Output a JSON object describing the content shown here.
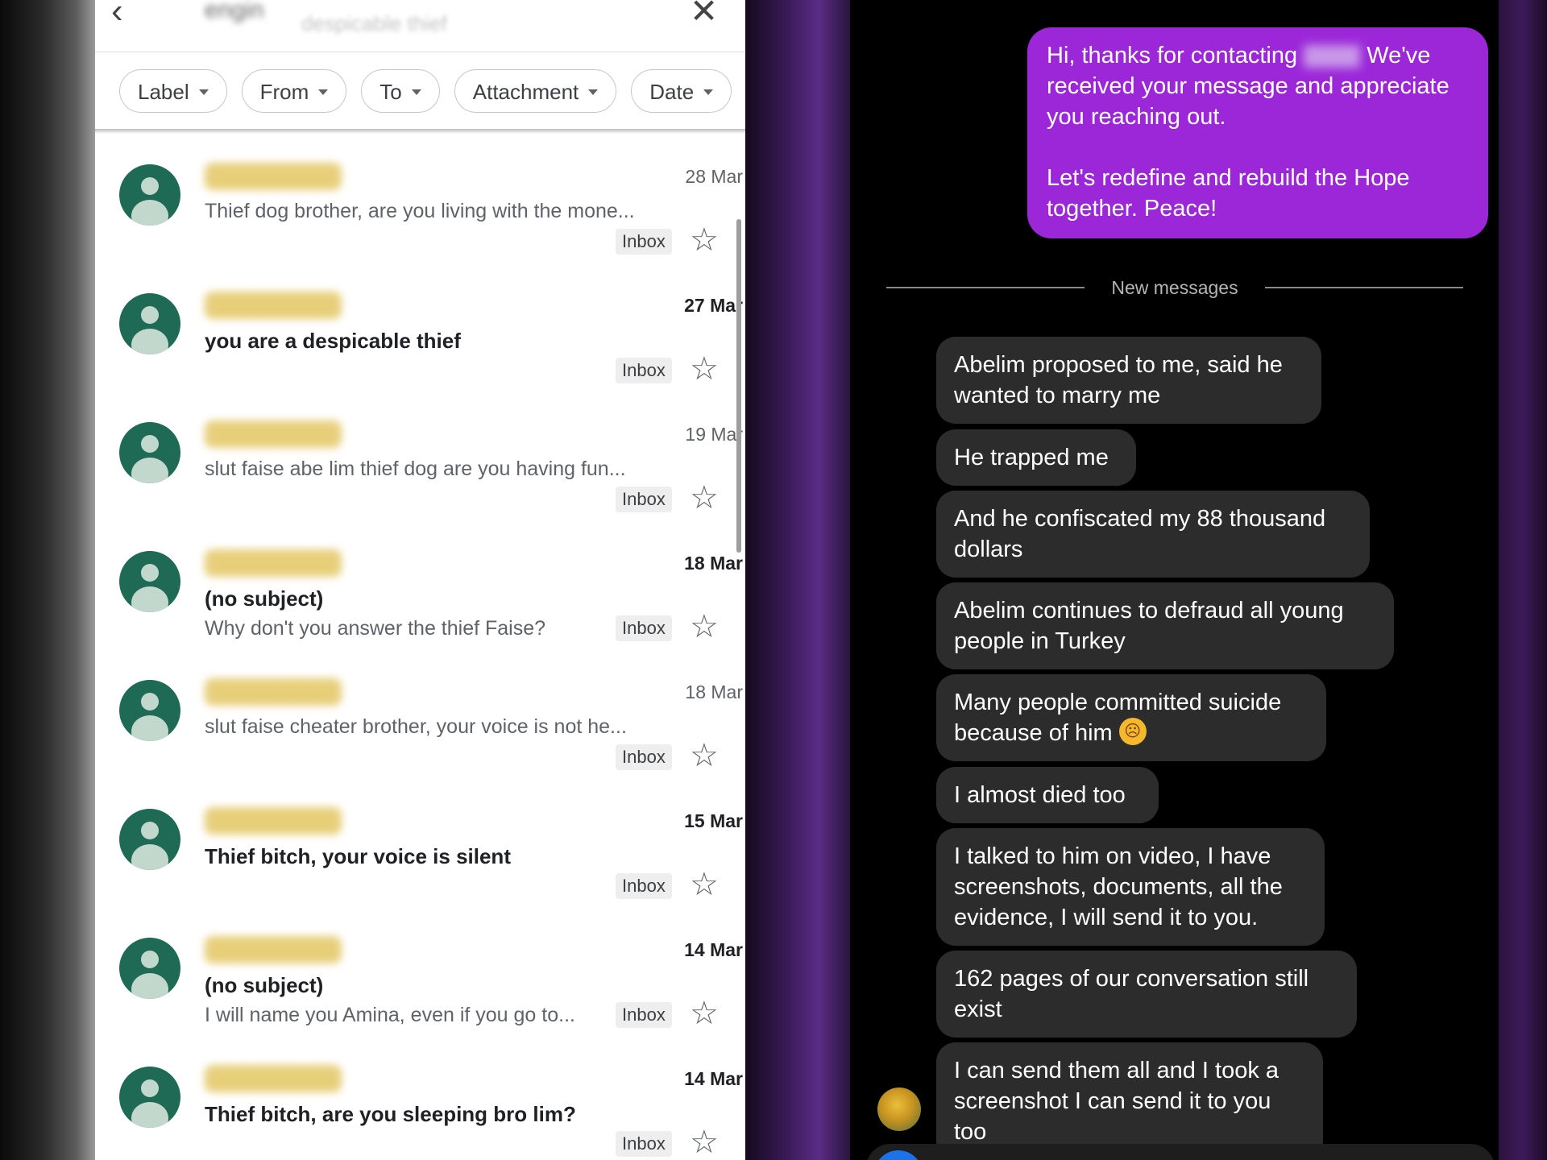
{
  "gmail": {
    "search_query": "engin",
    "search_ghost_text": "despicable thief",
    "filter_chips": [
      "Label",
      "From",
      "To",
      "Attachment",
      "Date"
    ],
    "emails": [
      {
        "date": "28 Mar",
        "unread": false,
        "subject": "",
        "snippet": "Thief dog brother, are you living with the mone...",
        "label": "Inbox"
      },
      {
        "date": "27 Mar",
        "unread": true,
        "subject": "you are a despicable thief",
        "snippet": "",
        "label": "Inbox"
      },
      {
        "date": "19 Mar",
        "unread": false,
        "subject": "",
        "snippet": "slut faise abe lim thief dog are you having fun...",
        "label": "Inbox"
      },
      {
        "date": "18 Mar",
        "unread": true,
        "subject": "(no subject)",
        "snippet": "Why don't you answer the thief Faise?",
        "label": "Inbox"
      },
      {
        "date": "18 Mar",
        "unread": false,
        "subject": "",
        "snippet": "slut faise cheater brother, your voice is not he...",
        "label": "Inbox"
      },
      {
        "date": "15 Mar",
        "unread": true,
        "subject": "Thief bitch, your voice is silent",
        "snippet": "",
        "label": "Inbox"
      },
      {
        "date": "14 Mar",
        "unread": true,
        "subject": "(no subject)",
        "snippet": "I will name you Amina, even if you go to...",
        "label": "Inbox"
      },
      {
        "date": "14 Mar",
        "unread": true,
        "subject": "Thief bitch, are you sleeping bro lim?",
        "snippet": "",
        "label": "Inbox"
      }
    ]
  },
  "chat": {
    "sent_message": {
      "para1_a": "Hi, thanks for contacting",
      "para1_b": "We've received your message and appreciate you reaching out.",
      "para2": "Let's redefine and rebuild the Hope together. Peace!"
    },
    "divider_label": "New messages",
    "received_messages": [
      "Abelim proposed to me, said he wanted to marry me",
      "He trapped me",
      "And he confiscated my 88 thousand dollars",
      "Abelim continues to defraud all young people in Turkey",
      "Many people committed suicide because of him",
      "I almost died too",
      "I talked to him on video, I have screenshots, documents, all the evidence, I will send it to you.",
      "162 pages of our conversation still exist",
      "I can send them all and I took a screenshot I can send it to you too"
    ],
    "colors": {
      "sent_bubble": "#9b27d9",
      "received_bubble": "#2c2c2c",
      "avatar_green": "#1e6a55"
    }
  }
}
